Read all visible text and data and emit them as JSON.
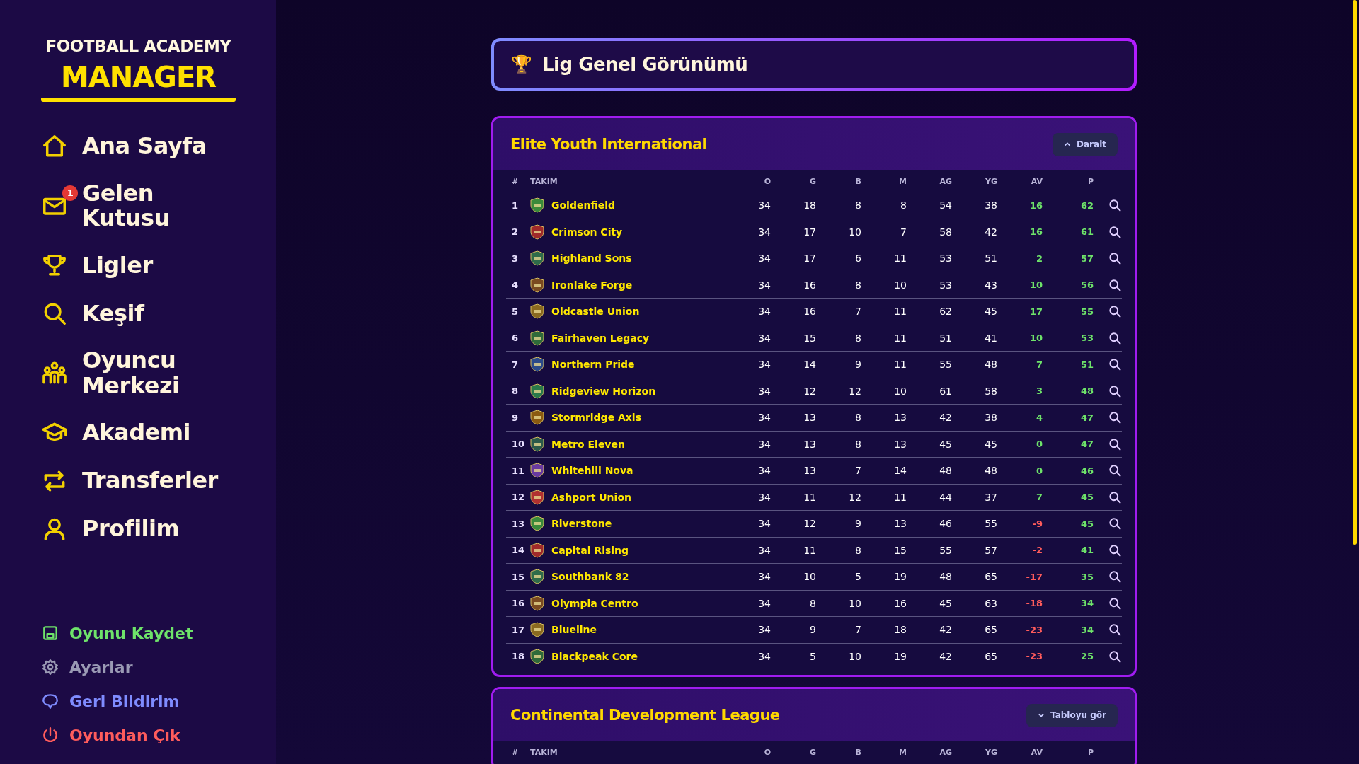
{
  "sidebar": {
    "logo_top": "FOOTBALL ACADEMY",
    "logo_main": "MANAGER",
    "nav_items": [
      {
        "label": "Ana Sayfa"
      },
      {
        "label": "Gelen Kutusu",
        "badge": "1"
      },
      {
        "label": "Ligler"
      },
      {
        "label": "Keşif"
      },
      {
        "label": "Oyuncu Merkezi"
      },
      {
        "label": "Akademi"
      },
      {
        "label": "Transferler"
      },
      {
        "label": "Profilim"
      }
    ],
    "footer_items": [
      {
        "label": "Oyunu Kaydet",
        "color": "#6ee36a"
      },
      {
        "label": "Ayarlar",
        "color": "#9a9ab4"
      },
      {
        "label": "Geri Bildirim",
        "color": "#7f8cff"
      },
      {
        "label": "Oyundan Çık",
        "color": "#ff5c5c"
      }
    ]
  },
  "page_title": {
    "icon": "🏆",
    "text": "Lig Genel Görünümü"
  },
  "leagues": [
    {
      "name": "Elite Youth International",
      "expanded": true,
      "toggle_label": "Daralt",
      "columns": [
        "#",
        "TAKIM",
        "O",
        "G",
        "B",
        "M",
        "AG",
        "YG",
        "AV",
        "P"
      ],
      "rows": [
        {
          "rank": "1",
          "team": "Goldenfield",
          "o": "34",
          "g": "18",
          "b": "8",
          "m": "8",
          "ag": "54",
          "yg": "38",
          "av": "16",
          "negative": false,
          "p": "62"
        },
        {
          "rank": "2",
          "team": "Crimson City",
          "o": "34",
          "g": "17",
          "b": "10",
          "m": "7",
          "ag": "58",
          "yg": "42",
          "av": "16",
          "negative": false,
          "p": "61"
        },
        {
          "rank": "3",
          "team": "Highland Sons",
          "o": "34",
          "g": "17",
          "b": "6",
          "m": "11",
          "ag": "53",
          "yg": "51",
          "av": "2",
          "negative": false,
          "p": "57"
        },
        {
          "rank": "4",
          "team": "Ironlake Forge",
          "o": "34",
          "g": "16",
          "b": "8",
          "m": "10",
          "ag": "53",
          "yg": "43",
          "av": "10",
          "negative": false,
          "p": "56"
        },
        {
          "rank": "5",
          "team": "Oldcastle Union",
          "o": "34",
          "g": "16",
          "b": "7",
          "m": "11",
          "ag": "62",
          "yg": "45",
          "av": "17",
          "negative": false,
          "p": "55"
        },
        {
          "rank": "6",
          "team": "Fairhaven Legacy",
          "o": "34",
          "g": "15",
          "b": "8",
          "m": "11",
          "ag": "51",
          "yg": "41",
          "av": "10",
          "negative": false,
          "p": "53"
        },
        {
          "rank": "7",
          "team": "Northern Pride",
          "o": "34",
          "g": "14",
          "b": "9",
          "m": "11",
          "ag": "55",
          "yg": "48",
          "av": "7",
          "negative": false,
          "p": "51"
        },
        {
          "rank": "8",
          "team": "Ridgeview Horizon",
          "o": "34",
          "g": "12",
          "b": "12",
          "m": "10",
          "ag": "61",
          "yg": "58",
          "av": "3",
          "negative": false,
          "p": "48"
        },
        {
          "rank": "9",
          "team": "Stormridge Axis",
          "o": "34",
          "g": "13",
          "b": "8",
          "m": "13",
          "ag": "42",
          "yg": "38",
          "av": "4",
          "negative": false,
          "p": "47"
        },
        {
          "rank": "10",
          "team": "Metro Eleven",
          "o": "34",
          "g": "13",
          "b": "8",
          "m": "13",
          "ag": "45",
          "yg": "45",
          "av": "0",
          "negative": false,
          "p": "47"
        },
        {
          "rank": "11",
          "team": "Whitehill Nova",
          "o": "34",
          "g": "13",
          "b": "7",
          "m": "14",
          "ag": "48",
          "yg": "48",
          "av": "0",
          "negative": false,
          "p": "46"
        },
        {
          "rank": "12",
          "team": "Ashport Union",
          "o": "34",
          "g": "11",
          "b": "12",
          "m": "11",
          "ag": "44",
          "yg": "37",
          "av": "7",
          "negative": false,
          "p": "45"
        },
        {
          "rank": "13",
          "team": "Riverstone",
          "o": "34",
          "g": "12",
          "b": "9",
          "m": "13",
          "ag": "46",
          "yg": "55",
          "av": "-9",
          "negative": true,
          "p": "45"
        },
        {
          "rank": "14",
          "team": "Capital Rising",
          "o": "34",
          "g": "11",
          "b": "8",
          "m": "15",
          "ag": "55",
          "yg": "57",
          "av": "-2",
          "negative": true,
          "p": "41"
        },
        {
          "rank": "15",
          "team": "Southbank 82",
          "o": "34",
          "g": "10",
          "b": "5",
          "m": "19",
          "ag": "48",
          "yg": "65",
          "av": "-17",
          "negative": true,
          "p": "35"
        },
        {
          "rank": "16",
          "team": "Olympia Centro",
          "o": "34",
          "g": "8",
          "b": "10",
          "m": "16",
          "ag": "45",
          "yg": "63",
          "av": "-18",
          "negative": true,
          "p": "34"
        },
        {
          "rank": "17",
          "team": "Blueline",
          "o": "34",
          "g": "9",
          "b": "7",
          "m": "18",
          "ag": "42",
          "yg": "65",
          "av": "-23",
          "negative": true,
          "p": "34"
        },
        {
          "rank": "18",
          "team": "Blackpeak Core",
          "o": "34",
          "g": "5",
          "b": "10",
          "m": "19",
          "ag": "42",
          "yg": "65",
          "av": "-23",
          "negative": true,
          "p": "25"
        }
      ]
    },
    {
      "name": "Continental Development League",
      "expanded": false,
      "toggle_label": "Tabloyu gör",
      "columns": [
        "#",
        "TAKIM",
        "O",
        "G",
        "B",
        "M",
        "AG",
        "YG",
        "AV",
        "P"
      ]
    }
  ]
}
